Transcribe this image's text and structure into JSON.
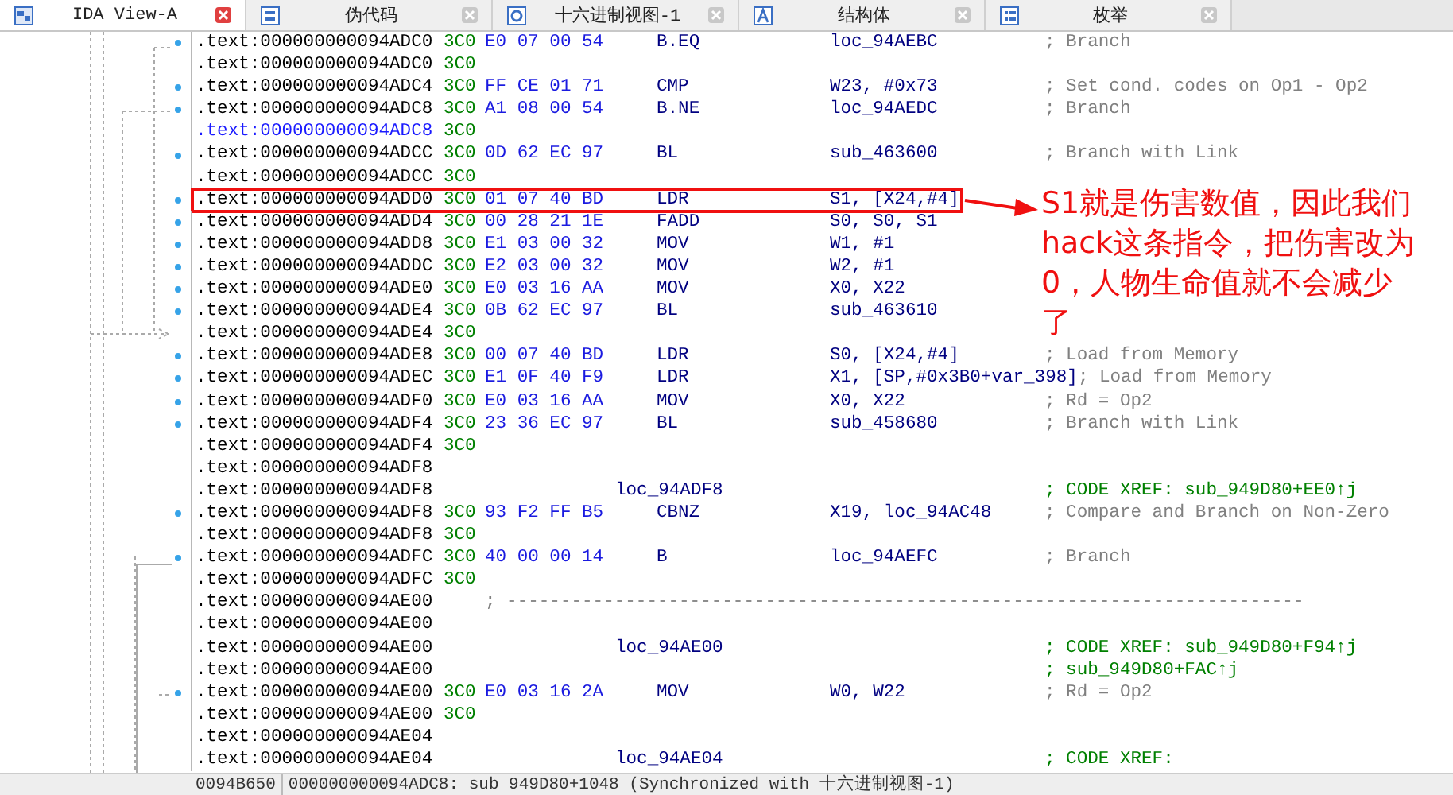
{
  "tabs": [
    {
      "label": "IDA View-A",
      "selected": true
    },
    {
      "label": "伪代码",
      "selected": false
    },
    {
      "label": "十六进制视图-1",
      "selected": false
    },
    {
      "label": "结构体",
      "selected": false
    },
    {
      "label": "枚举",
      "selected": false
    }
  ],
  "listing": {
    "rows": [
      {
        "address": ".text:000000000094ADC0",
        "sp": "3C0",
        "bytes": "E0 07 00 54",
        "mnemonic": "B.EQ",
        "operands": "loc_94AEBC",
        "comment": "; Branch",
        "selected": false,
        "boxed": false
      },
      {
        "address": ".text:000000000094ADC0",
        "sp": "3C0",
        "selected": false,
        "boxed": false
      },
      {
        "address": ".text:000000000094ADC4",
        "sp": "3C0",
        "bytes": "FF CE 01 71",
        "mnemonic": "CMP",
        "operands": "W23, #0x73",
        "comment": "; Set cond. codes on Op1 - Op2",
        "selected": false,
        "boxed": false
      },
      {
        "address": ".text:000000000094ADC8",
        "sp": "3C0",
        "bytes": "A1 08 00 54",
        "mnemonic": "B.NE",
        "operands": "loc_94AEDC",
        "comment": "; Branch",
        "selected": false,
        "boxed": false
      },
      {
        "address": ".text:000000000094ADC8",
        "sp": "3C0",
        "selected": true,
        "boxed": false
      },
      {
        "address": ".text:000000000094ADCC",
        "sp": "3C0",
        "bytes": "0D 62 EC 97",
        "mnemonic": "BL",
        "operands": "sub_463600",
        "comment": "; Branch with Link",
        "selected": false,
        "boxed": false
      },
      {
        "address": ".text:000000000094ADCC",
        "sp": "3C0",
        "selected": false,
        "boxed": false
      },
      {
        "address": ".text:000000000094ADD0",
        "sp": "3C0",
        "bytes": "01 07 40 BD",
        "mnemonic": "LDR",
        "operands": "S1, [X24,#4]",
        "selected": false,
        "boxed": true
      },
      {
        "address": ".text:000000000094ADD4",
        "sp": "3C0",
        "bytes": "00 28 21 1E",
        "mnemonic": "FADD",
        "operands": "S0, S0, S1",
        "selected": false,
        "boxed": false
      },
      {
        "address": ".text:000000000094ADD8",
        "sp": "3C0",
        "bytes": "E1 03 00 32",
        "mnemonic": "MOV",
        "operands": "W1, #1",
        "selected": false,
        "boxed": false
      },
      {
        "address": ".text:000000000094ADDC",
        "sp": "3C0",
        "bytes": "E2 03 00 32",
        "mnemonic": "MOV",
        "operands": "W2, #1",
        "selected": false,
        "boxed": false
      },
      {
        "address": ".text:000000000094ADE0",
        "sp": "3C0",
        "bytes": "E0 03 16 AA",
        "mnemonic": "MOV",
        "operands": "X0, X22",
        "selected": false,
        "boxed": false
      },
      {
        "address": ".text:000000000094ADE4",
        "sp": "3C0",
        "bytes": "0B 62 EC 97",
        "mnemonic": "BL",
        "operands": "sub_463610",
        "selected": false,
        "boxed": false
      },
      {
        "address": ".text:000000000094ADE4",
        "sp": "3C0",
        "selected": false,
        "boxed": false
      },
      {
        "address": ".text:000000000094ADE8",
        "sp": "3C0",
        "bytes": "00 07 40 BD",
        "mnemonic": "LDR",
        "operands": "S0, [X24,#4]",
        "comment": "; Load from Memory",
        "selected": false,
        "boxed": false
      },
      {
        "address": ".text:000000000094ADEC",
        "sp": "3C0",
        "bytes": "E1 0F 40 F9",
        "mnemonic": "LDR",
        "operands": "X1, [SP,#0x3B0+var_398]",
        "comment": "; Load from Memory",
        "selected": false,
        "boxed": false
      },
      {
        "address": ".text:000000000094ADF0",
        "sp": "3C0",
        "bytes": "E0 03 16 AA",
        "mnemonic": "MOV",
        "operands": "X0, X22",
        "comment": "; Rd = Op2",
        "selected": false,
        "boxed": false
      },
      {
        "address": ".text:000000000094ADF4",
        "sp": "3C0",
        "bytes": "23 36 EC 97",
        "mnemonic": "BL",
        "operands": "sub_458680",
        "comment": "; Branch with Link",
        "selected": false,
        "boxed": false
      },
      {
        "address": ".text:000000000094ADF4",
        "sp": "3C0",
        "selected": false,
        "boxed": false
      },
      {
        "address": ".text:000000000094ADF8",
        "selected": false,
        "boxed": false
      },
      {
        "address": ".text:000000000094ADF8",
        "label": "loc_94ADF8",
        "xref": "; CODE XREF: sub_949D80+EE0↑j",
        "selected": false,
        "boxed": false
      },
      {
        "address": ".text:000000000094ADF8",
        "sp": "3C0",
        "bytes": "93 F2 FF B5",
        "mnemonic": "CBNZ",
        "operands": "X19, loc_94AC48",
        "comment": "; Compare and Branch on Non-Zero",
        "selected": false,
        "boxed": false
      },
      {
        "address": ".text:000000000094ADF8",
        "sp": "3C0",
        "selected": false,
        "boxed": false
      },
      {
        "address": ".text:000000000094ADFC",
        "sp": "3C0",
        "bytes": "40 00 00 14",
        "mnemonic": "B",
        "operands": "loc_94AEFC",
        "comment": "; Branch",
        "selected": false,
        "boxed": false
      },
      {
        "address": ".text:000000000094ADFC",
        "sp": "3C0",
        "selected": false,
        "boxed": false
      },
      {
        "address": ".text:000000000094AE00",
        "separator": "; --------------------------------------------------------------------------",
        "selected": false,
        "boxed": false
      },
      {
        "address": ".text:000000000094AE00",
        "selected": false,
        "boxed": false
      },
      {
        "address": ".text:000000000094AE00",
        "label": "loc_94AE00",
        "xref": "; CODE XREF: sub_949D80+F94↑j",
        "selected": false,
        "boxed": false
      },
      {
        "address": ".text:000000000094AE00",
        "xref": "; sub_949D80+FAC↑j",
        "selected": false,
        "boxed": false
      },
      {
        "address": ".text:000000000094AE00",
        "sp": "3C0",
        "bytes": "E0 03 16 2A",
        "mnemonic": "MOV",
        "operands": "W0, W22",
        "comment": "; Rd = Op2",
        "selected": false,
        "boxed": false
      },
      {
        "address": ".text:000000000094AE00",
        "sp": "3C0",
        "selected": false,
        "boxed": false
      },
      {
        "address": ".text:000000000094AE04",
        "selected": false,
        "boxed": false
      },
      {
        "address": ".text:000000000094AE04",
        "label": "loc_94AE04",
        "xref": "; CODE XREF:",
        "selected": false,
        "boxed": false
      }
    ]
  },
  "annotation": {
    "text": "S1就是伤害数值，因此我们hack这条指令，把伤害改为0，人物生命值就不会减少了"
  },
  "status_bar": {
    "offset": "0094B650",
    "location": "000000000094ADC8: sub 949D80+1048 (Synchronized with 十六进制视图-1)"
  }
}
